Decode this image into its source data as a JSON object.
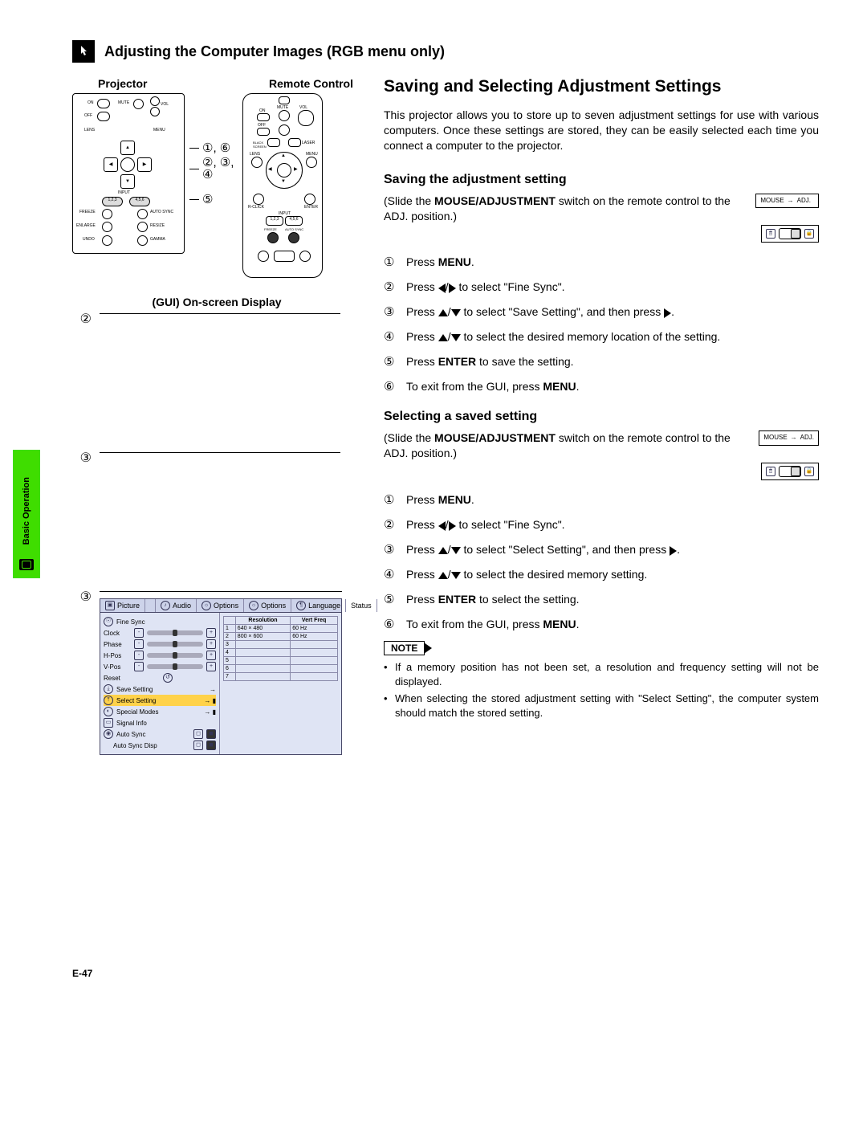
{
  "header": {
    "title": "Adjusting the Computer Images (RGB menu only)"
  },
  "side_tab": "Basic Operation",
  "page_number": "E-47",
  "left": {
    "projector_label": "Projector",
    "remote_label": "Remote Control",
    "callouts": [
      "①, ⑥",
      "②, ③, ④",
      "⑤"
    ],
    "gui_title": "(GUI) On-screen Display",
    "gui_markers": [
      "②",
      "③",
      "③"
    ],
    "projector_labels": {
      "on": "ON",
      "mute": "MUTE",
      "off": "OFF",
      "vol": "VOL",
      "lens": "LENS",
      "menu": "MENU",
      "input": "INPUT",
      "freeze": "FREEZE",
      "auto_sync": "AUTO SYNC",
      "enlarge": "ENLARGE",
      "resize": "RESIZE",
      "undo": "UNDO",
      "gamma": "GAMMA",
      "b123": "1,2,3",
      "b456": "4,5,6"
    },
    "remote_labels": {
      "on": "ON",
      "mute": "MUTE",
      "off": "OFF",
      "vol": "VOL",
      "black_screen": "BLACK\nSCREEN",
      "laser": "LASER",
      "lens": "LENS",
      "menu": "MENU",
      "rclick": "R-CLICK",
      "enter": "ENTER",
      "input": "INPUT",
      "b123": "1,2,3",
      "b456": "4,5,6",
      "freeze": "FREEZE",
      "auto_sync": "AUTO SYNC"
    },
    "osd": {
      "tabs": [
        "Picture",
        "Fine Sync",
        "Audio",
        "Options",
        "Options",
        "Language",
        "Status"
      ],
      "fine_sync_label": "Fine Sync",
      "rows": [
        "Clock",
        "Phase",
        "H-Pos",
        "V-Pos"
      ],
      "reset": "Reset",
      "save_setting": "Save Setting",
      "select_setting": "Select Setting",
      "special_modes": "Special Modes",
      "signal_info": "Signal Info",
      "auto_sync": "Auto Sync",
      "auto_sync_disp": "Auto Sync Disp",
      "table_headers": [
        "",
        "Resolution",
        "Vert Freq"
      ],
      "table_rows": [
        [
          "1",
          "640 × 480",
          "60 Hz"
        ],
        [
          "2",
          "800 × 600",
          "60 Hz"
        ],
        [
          "3",
          "",
          ""
        ],
        [
          "4",
          "",
          ""
        ],
        [
          "5",
          "",
          ""
        ],
        [
          "6",
          "",
          ""
        ],
        [
          "7",
          "",
          ""
        ]
      ]
    }
  },
  "right": {
    "title": "Saving and Selecting Adjustment Settings",
    "intro": "This projector allows you to store up to seven adjustment settings for use with various computers. Once these settings are stored, they can be easily selected each time you connect a computer to the projector.",
    "section_a": {
      "heading": "Saving the adjustment setting",
      "slide_pre": "(Slide the ",
      "slide_bold": "MOUSE/ADJUSTMENT",
      "slide_post": " switch on the remote control to the ADJ. position.)",
      "switch_labels": {
        "mouse": "MOUSE",
        "adj": "ADJ."
      },
      "steps": [
        {
          "n": "①",
          "pre": "Press ",
          "b1": "MENU",
          "post": "."
        },
        {
          "n": "②",
          "pre": "Press ",
          "sym": "lr",
          "post": " to select \"Fine Sync\"."
        },
        {
          "n": "③",
          "pre": "Press ",
          "sym": "ud",
          "mid": " to select \"Save Setting\", and then press ",
          "sym2": "r",
          "post": "."
        },
        {
          "n": "④",
          "pre": "Press ",
          "sym": "ud",
          "post": " to select the desired memory location of the setting."
        },
        {
          "n": "⑤",
          "pre": "Press ",
          "b1": "ENTER",
          "post": " to save the setting."
        },
        {
          "n": "⑥",
          "pre": "To exit from the GUI, press ",
          "b1": "MENU",
          "post": "."
        }
      ]
    },
    "section_b": {
      "heading": "Selecting a saved setting",
      "slide_pre": "(Slide the ",
      "slide_bold": "MOUSE/ADJUSTMENT",
      "slide_post": " switch on the remote control to the ADJ. position.)",
      "switch_labels": {
        "mouse": "MOUSE",
        "adj": "ADJ."
      },
      "steps": [
        {
          "n": "①",
          "pre": "Press ",
          "b1": "MENU",
          "post": "."
        },
        {
          "n": "②",
          "pre": "Press ",
          "sym": "lr",
          "post": " to select \"Fine Sync\"."
        },
        {
          "n": "③",
          "pre": "Press ",
          "sym": "ud",
          "mid": " to select \"Select Setting\", and then press ",
          "sym2": "r",
          "post": "."
        },
        {
          "n": "④",
          "pre": "Press ",
          "sym": "ud",
          "post": " to select the desired memory setting."
        },
        {
          "n": "⑤",
          "pre": "Press ",
          "b1": "ENTER",
          "post": " to select the setting."
        },
        {
          "n": "⑥",
          "pre": "To exit from the GUI, press ",
          "b1": "MENU",
          "post": "."
        }
      ]
    },
    "note_label": "NOTE",
    "notes": [
      "If a memory position has not been set, a resolution and frequency setting will not be displayed.",
      "When selecting the stored adjustment setting with \"Select Setting\", the computer system should match the stored setting."
    ]
  }
}
